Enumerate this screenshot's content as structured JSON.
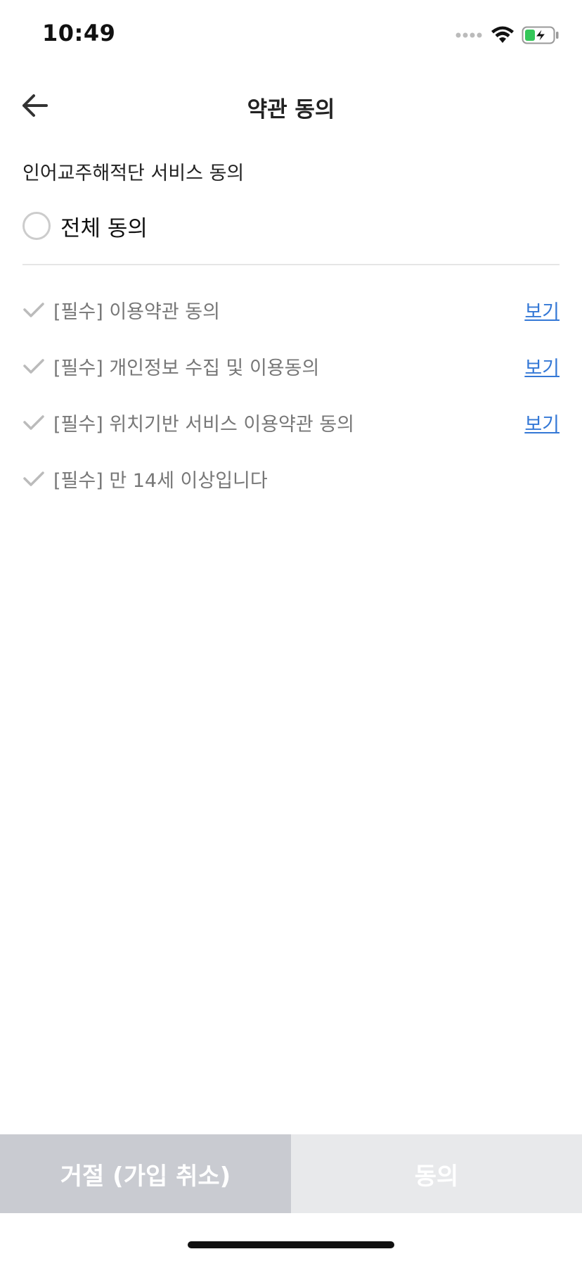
{
  "status_bar": {
    "time": "10:49",
    "icons": [
      "signal-dots-icon",
      "wifi-icon",
      "battery-charging-icon"
    ],
    "battery_color": "#34c759"
  },
  "nav": {
    "back_icon": "arrow-left-icon",
    "title": "약관 동의"
  },
  "section": {
    "service_title": "인어교주해적단 서비스 동의",
    "agree_all_label": "전체 동의"
  },
  "terms": [
    {
      "label": "[필수] 이용약관 동의",
      "view_label": "보기"
    },
    {
      "label": "[필수] 개인정보 수집 및 이용동의",
      "view_label": "보기"
    },
    {
      "label": "[필수] 위치기반 서비스 이용약관 동의",
      "view_label": "보기"
    },
    {
      "label": "[필수] 만 14세 이상입니다",
      "view_label": ""
    }
  ],
  "buttons": {
    "decline": "거절 (가입 취소)",
    "agree": "동의"
  },
  "colors": {
    "link": "#3478d6",
    "decline_bg": "#c9cbd1",
    "agree_bg": "#e8e9eb",
    "check": "#bbbbbb"
  }
}
